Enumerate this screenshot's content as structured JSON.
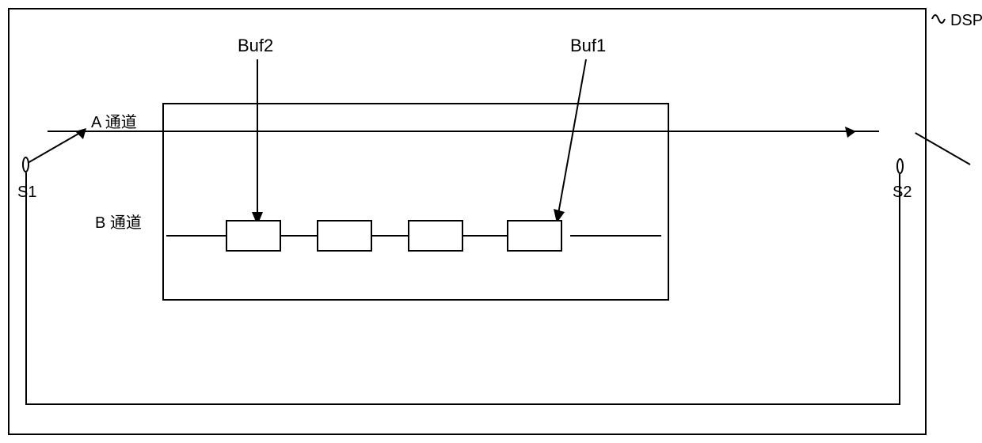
{
  "labels": {
    "dsp": "DSP",
    "buf2": "Buf2",
    "buf1": "Buf1",
    "a_channel": "A 通道",
    "b_channel": "B 通道",
    "s1": "S1",
    "s2": "S2"
  },
  "diagram": {
    "buffer_count": 4,
    "channels": [
      "A",
      "B"
    ],
    "terminals": [
      "S1",
      "S2"
    ]
  }
}
